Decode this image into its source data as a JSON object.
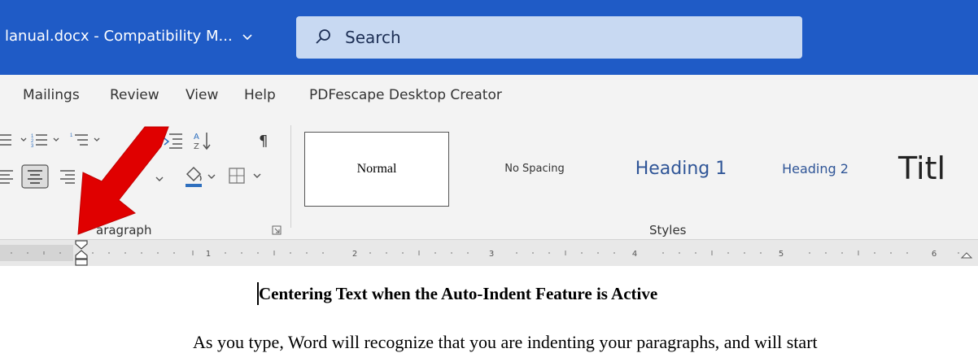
{
  "titlebar": {
    "doc_title": "lanual.docx - Compatibility M...",
    "search_placeholder": "Search"
  },
  "tabs": [
    "Mailings",
    "Review",
    "View",
    "Help",
    "PDFescape Desktop Creator"
  ],
  "ribbon": {
    "paragraph_label": "aragraph",
    "styles_label": "Styles",
    "styles": [
      "Normal",
      "No Spacing",
      "Heading 1",
      "Heading 2",
      "Titl"
    ]
  },
  "ruler": {
    "numbers": [
      "1",
      "2",
      "3",
      "4",
      "5",
      "6"
    ]
  },
  "document": {
    "heading": "Centering Text when the Auto-Indent Feature is Active",
    "body_line": "As you type, Word will recognize that you are indenting your paragraphs, and will start"
  },
  "colors": {
    "titlebar": "#1f5bc6",
    "search_box": "#c8d9f2",
    "arrow": "#e00000",
    "heading_style": "#2f5597"
  }
}
